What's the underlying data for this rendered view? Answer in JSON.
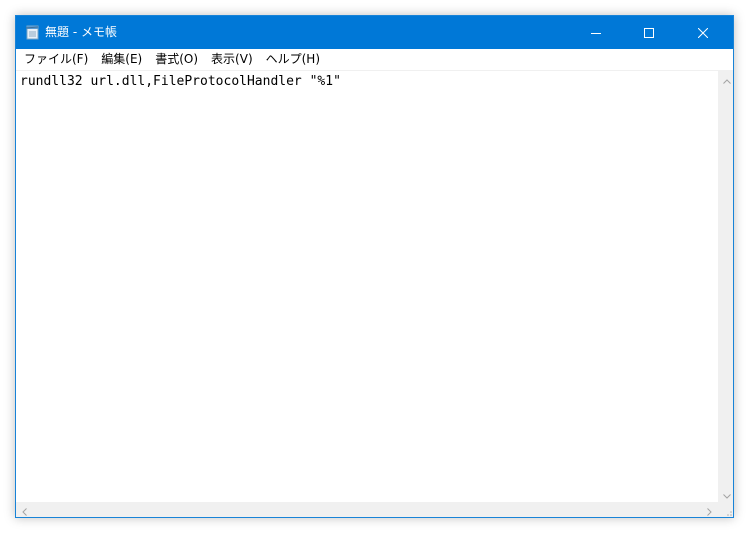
{
  "window": {
    "title": "無題 - メモ帳",
    "accent_color": "#0078d7"
  },
  "caption_buttons": {
    "minimize_icon": "minimize-icon",
    "maximize_icon": "maximize-icon",
    "close_icon": "close-icon"
  },
  "menu": {
    "items": [
      {
        "label": "ファイル(F)"
      },
      {
        "label": "編集(E)"
      },
      {
        "label": "書式(O)"
      },
      {
        "label": "表示(V)"
      },
      {
        "label": "ヘルプ(H)"
      }
    ]
  },
  "editor": {
    "content": "rundll32 url.dll,FileProtocolHandler \"%1\""
  },
  "scrollbars": {
    "vertical_up_icon": "chevron-up-icon",
    "vertical_down_icon": "chevron-down-icon",
    "horizontal_left_icon": "chevron-left-icon",
    "horizontal_right_icon": "chevron-right-icon"
  }
}
